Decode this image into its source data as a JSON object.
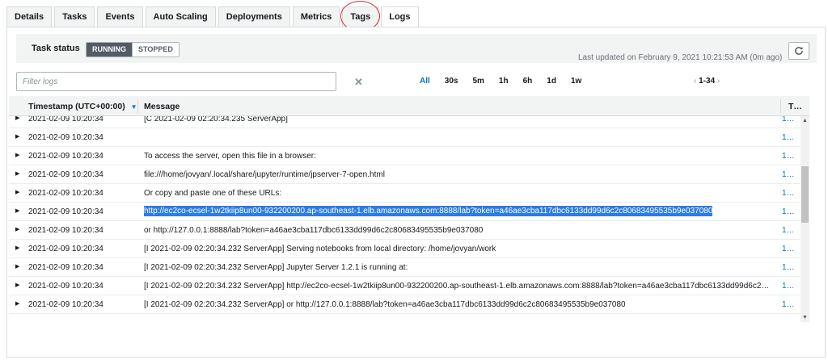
{
  "tabs": [
    {
      "label": "Details",
      "active": false
    },
    {
      "label": "Tasks",
      "active": false
    },
    {
      "label": "Events",
      "active": false
    },
    {
      "label": "Auto Scaling",
      "active": false
    },
    {
      "label": "Deployments",
      "active": false
    },
    {
      "label": "Metrics",
      "active": false
    },
    {
      "label": "Tags",
      "active": false
    },
    {
      "label": "Logs",
      "active": true
    }
  ],
  "task_status": {
    "label": "Task status",
    "options": [
      "RUNNING",
      "STOPPED"
    ],
    "selected": "RUNNING"
  },
  "last_updated": "Last updated on February 9, 2021 10:21:53 AM (0m ago)",
  "filter": {
    "placeholder": "Filter logs",
    "value": ""
  },
  "time_ranges": [
    "All",
    "30s",
    "5m",
    "1h",
    "6h",
    "1d",
    "1w"
  ],
  "selected_range": "All",
  "pagination": {
    "label": "1-34"
  },
  "table": {
    "columns": [
      "Timestamp (UTC+00:00)",
      "Message",
      "T…"
    ],
    "rows": [
      {
        "timestamp": "2021-02-09 10:20:34",
        "message": "[C 2021-02-09 02:20:34.235 ServerApp]",
        "task": "1…"
      },
      {
        "timestamp": "2021-02-09 10:20:34",
        "message": "",
        "task": "1…"
      },
      {
        "timestamp": "2021-02-09 10:20:34",
        "message": "To access the server, open this file in a browser:",
        "task": "1…"
      },
      {
        "timestamp": "2021-02-09 10:20:34",
        "message": "file:///home/jovyan/.local/share/jupyter/runtime/jpserver-7-open.html",
        "task": "1…"
      },
      {
        "timestamp": "2021-02-09 10:20:34",
        "message": "Or copy and paste one of these URLs:",
        "task": "1…"
      },
      {
        "timestamp": "2021-02-09 10:20:34",
        "message": "http://ec2co-ecsel-1w2tkiip8un00-932200200.ap-southeast-1.elb.amazonaws.com:8888/lab?token=a46ae3cba117dbc6133dd99d6c2c80683495535b9e037080",
        "task": "1…",
        "highlighted": true
      },
      {
        "timestamp": "2021-02-09 10:20:34",
        "message": "or http://127.0.0.1:8888/lab?token=a46ae3cba117dbc6133dd99d6c2c80683495535b9e037080",
        "task": "1…"
      },
      {
        "timestamp": "2021-02-09 10:20:34",
        "message": "[I 2021-02-09 02:20:34.232 ServerApp] Serving notebooks from local directory: /home/jovyan/work",
        "task": "1…"
      },
      {
        "timestamp": "2021-02-09 10:20:34",
        "message": "[I 2021-02-09 02:20:34.232 ServerApp] Jupyter Server 1.2.1 is running at:",
        "task": "1…"
      },
      {
        "timestamp": "2021-02-09 10:20:34",
        "message": "[I 2021-02-09 02:20:34.232 ServerApp] http://ec2co-ecsel-1w2tkiip8un00-932200200.ap-southeast-1.elb.amazonaws.com:8888/lab?token=a46ae3cba117dbc6133dd99d6c2…",
        "task": "1…"
      },
      {
        "timestamp": "2021-02-09 10:20:34",
        "message": "[I 2021-02-09 02:20:34.232 ServerApp] or http://127.0.0.1:8888/lab?token=a46ae3cba117dbc6133dd99d6c2c80683495535b9e037080",
        "task": "1…"
      }
    ]
  }
}
